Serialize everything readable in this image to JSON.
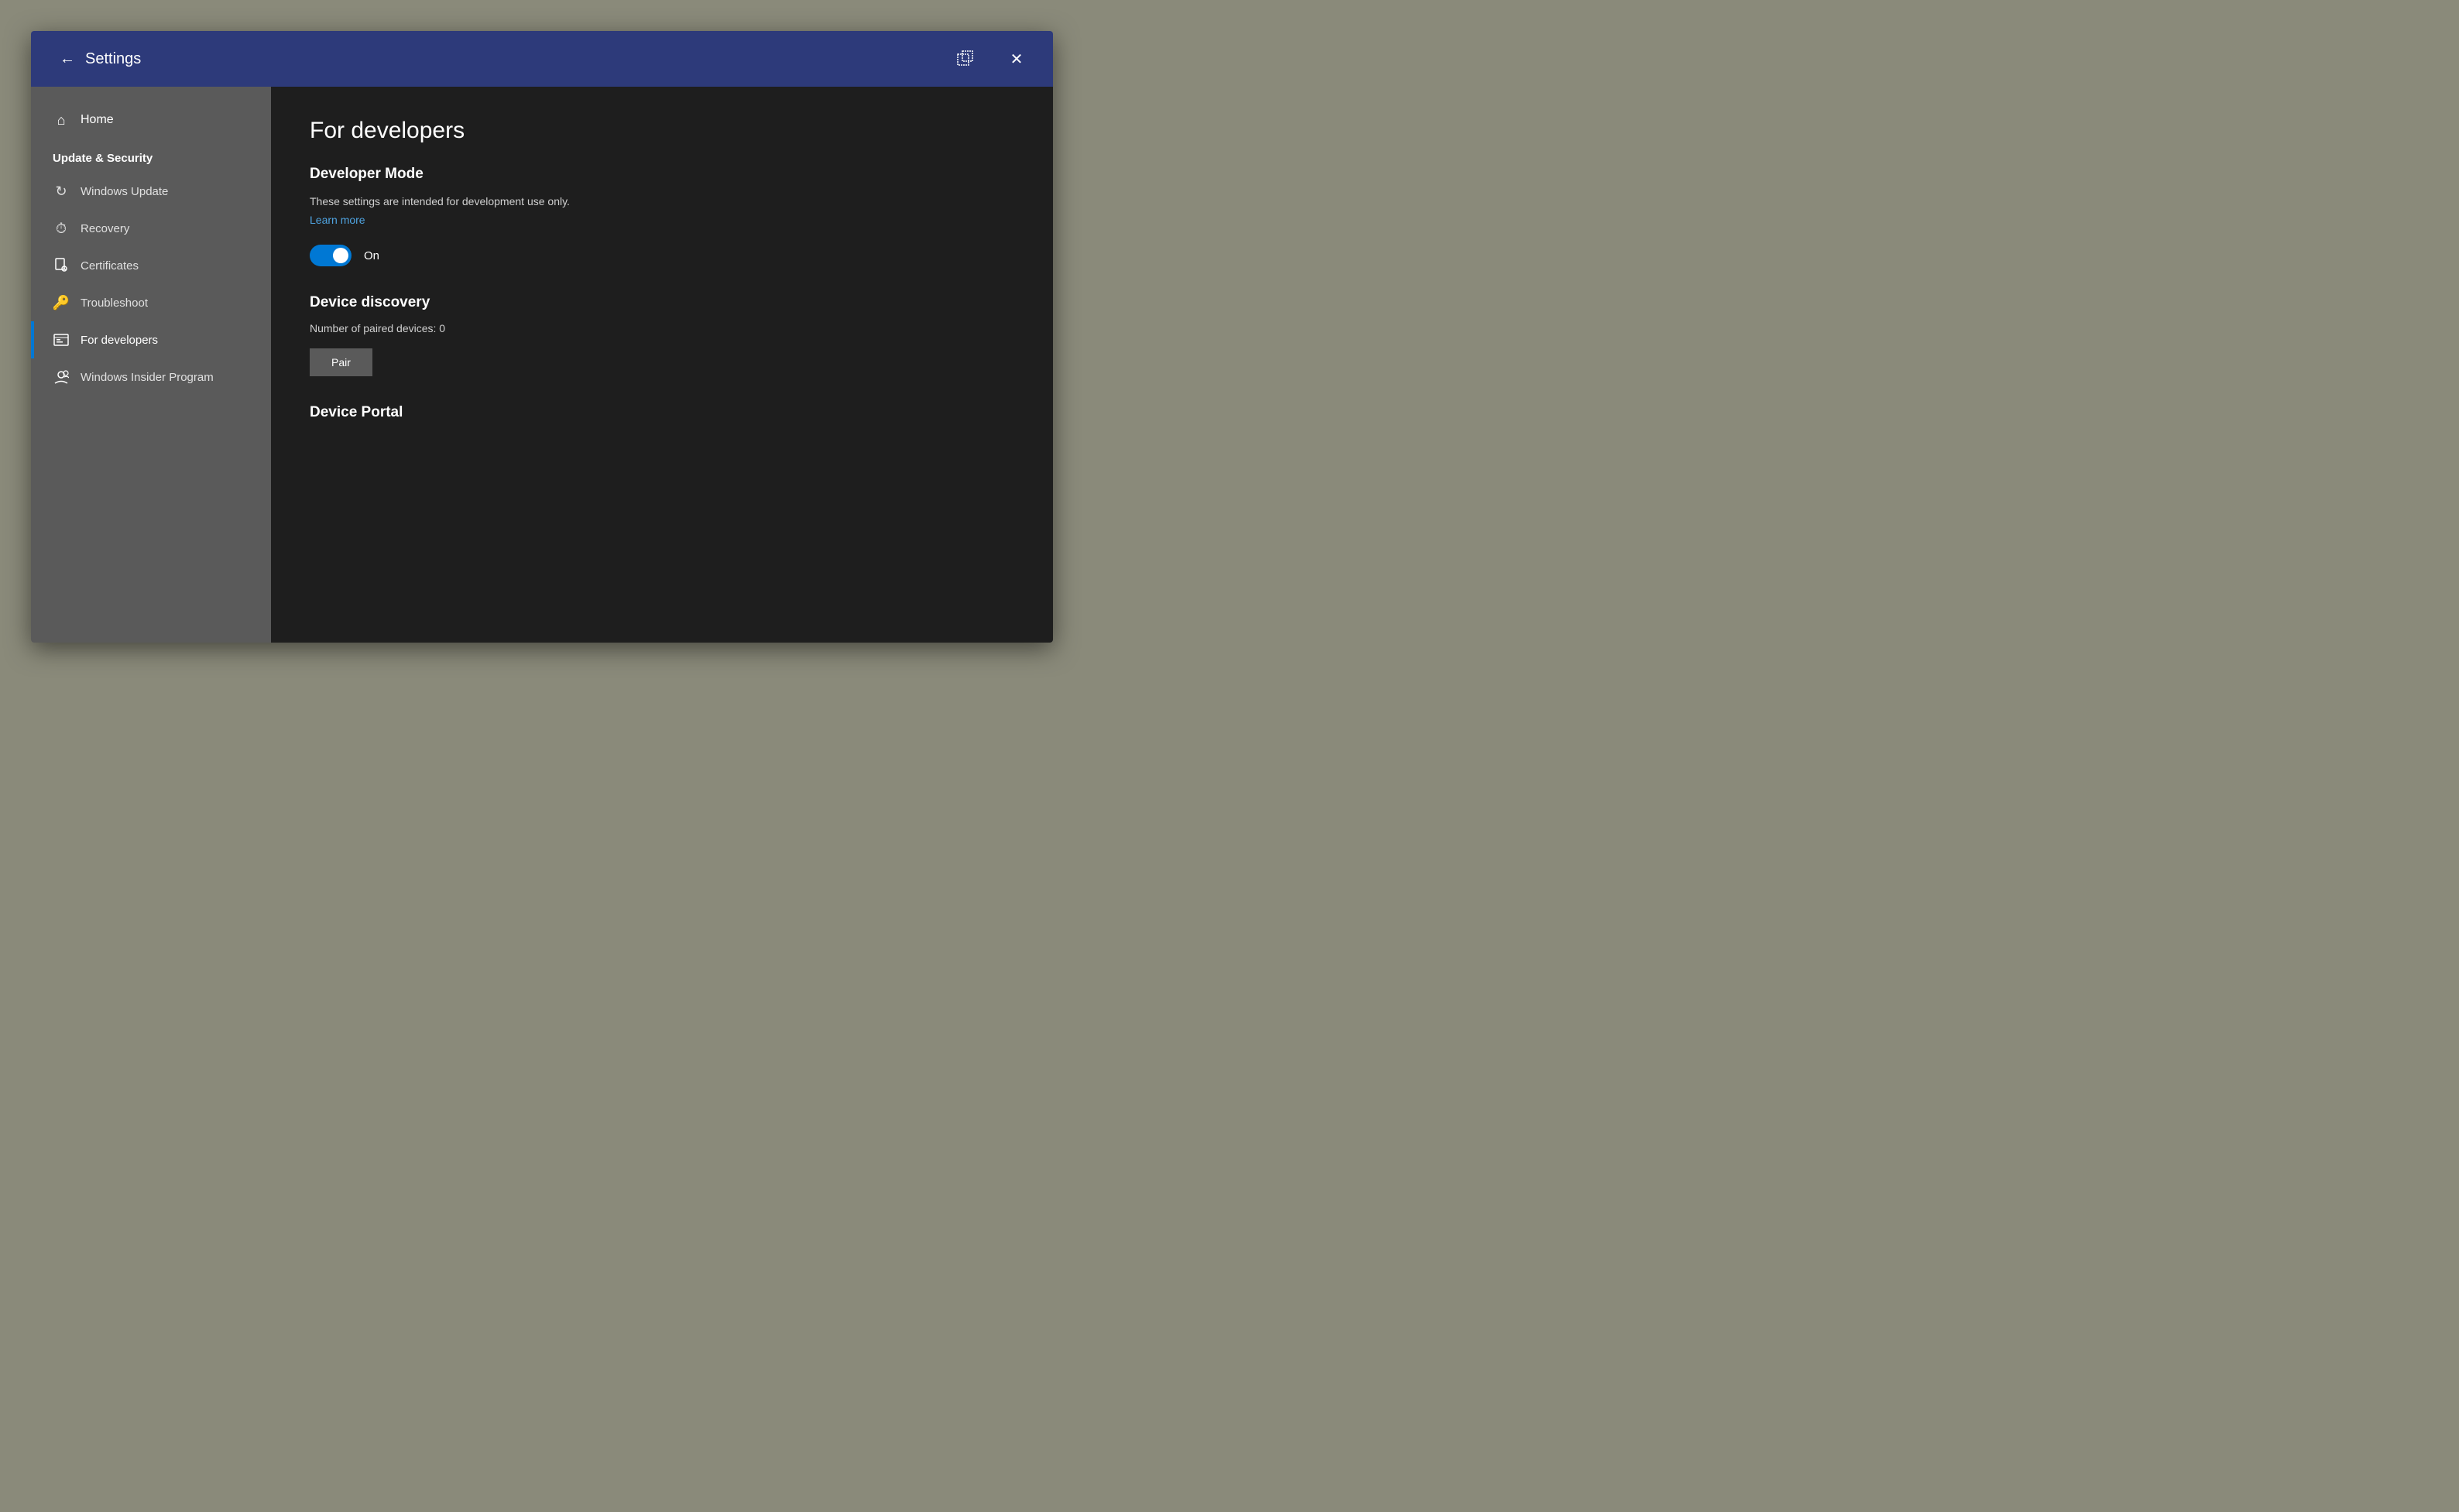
{
  "titlebar": {
    "back_label": "←",
    "title": "Settings",
    "restore_label": "⧉",
    "close_label": "✕"
  },
  "sidebar": {
    "home_label": "Home",
    "section_title": "Update & Security",
    "items": [
      {
        "id": "windows-update",
        "label": "Windows Update",
        "icon": "↻"
      },
      {
        "id": "recovery",
        "label": "Recovery",
        "icon": "⏱"
      },
      {
        "id": "certificates",
        "label": "Certificates",
        "icon": "🗎"
      },
      {
        "id": "troubleshoot",
        "label": "Troubleshoot",
        "icon": "🔑"
      },
      {
        "id": "for-developers",
        "label": "For developers",
        "icon": "⊞",
        "active": true
      },
      {
        "id": "windows-insider",
        "label": "Windows Insider Program",
        "icon": "👤"
      }
    ]
  },
  "main": {
    "page_title": "For developers",
    "developer_mode": {
      "heading": "Developer Mode",
      "description": "These settings are intended for development use only.",
      "learn_more": "Learn more",
      "toggle_state": "On"
    },
    "device_discovery": {
      "heading": "Device discovery",
      "paired_devices_label": "Number of paired devices: 0",
      "pair_button_label": "Pair"
    },
    "device_portal": {
      "heading": "Device Portal"
    }
  }
}
